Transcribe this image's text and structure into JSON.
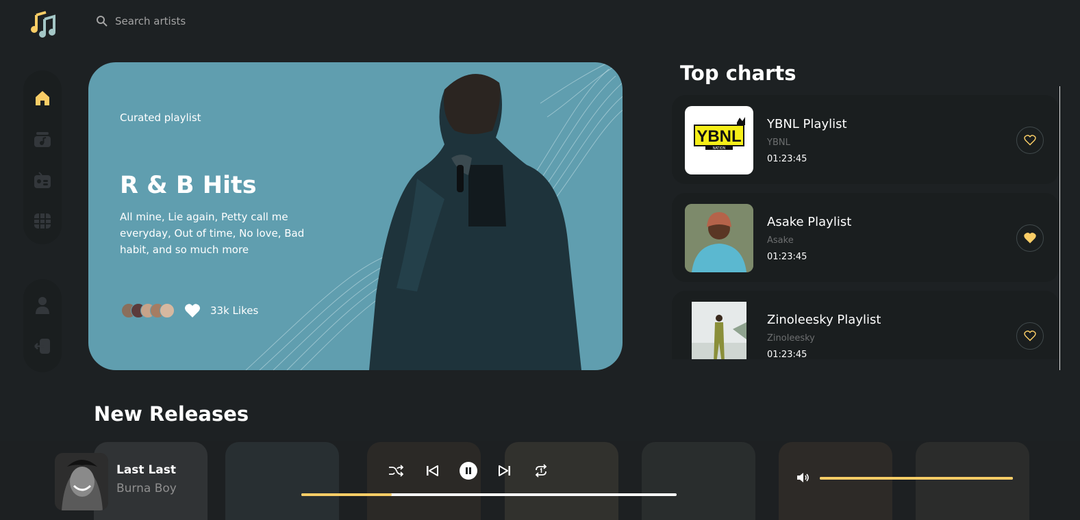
{
  "search": {
    "placeholder": "Search artists"
  },
  "hero": {
    "kicker": "Curated playlist",
    "title": "R & B Hits",
    "description": "All mine, Lie again, Petty call me everyday, Out of time, No love, Bad habit, and so much more",
    "likes": "33k Likes"
  },
  "top_charts": {
    "title": "Top charts",
    "items": [
      {
        "name": "YBNL Playlist",
        "artist": "YBNL",
        "duration": "01:23:45",
        "liked": false,
        "logo_text": "YBNL",
        "logo_sub": "NATION"
      },
      {
        "name": "Asake Playlist",
        "artist": "Asake",
        "duration": "01:23:45",
        "liked": true
      },
      {
        "name": "Zinoleesky Playlist",
        "artist": "Zinoleesky",
        "duration": "01:23:45",
        "liked": false
      }
    ]
  },
  "new_releases": {
    "title": "New Releases"
  },
  "player": {
    "track": "Last Last",
    "artist": "Burna Boy",
    "progress": 0.24,
    "volume": 1.0
  },
  "colors": {
    "accent": "#facd66",
    "bg": "#1d2123",
    "hero": "#609eaf"
  }
}
